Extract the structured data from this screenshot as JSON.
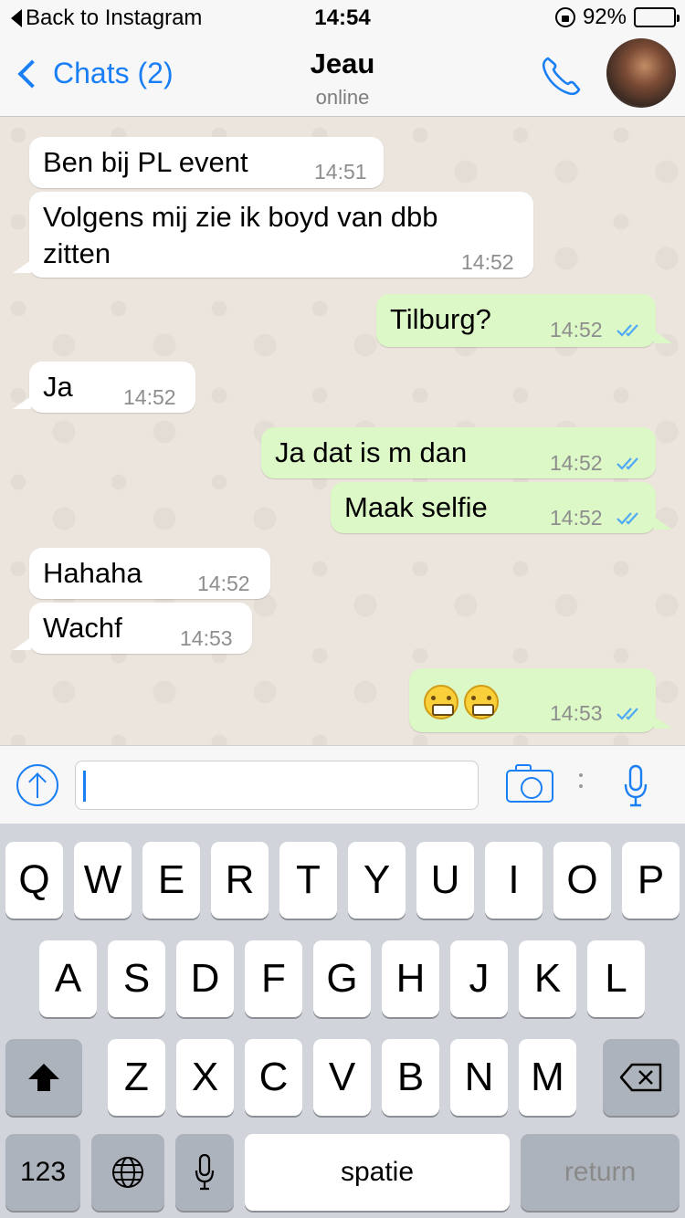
{
  "status_bar": {
    "back_label": "Back to Instagram",
    "time": "14:54",
    "battery": "92%",
    "battery_level": 0.92
  },
  "nav": {
    "back_label": "Chats (2)",
    "contact_name": "Jeau",
    "contact_status": "online",
    "accent_color": "#1a7ff5"
  },
  "messages": [
    {
      "direction": "in",
      "text": "Ben bij PL event",
      "time": "14:51"
    },
    {
      "direction": "in",
      "text": "Volgens mij zie ik boyd van dbb zitten",
      "time": "14:52"
    },
    {
      "direction": "out",
      "text": "Tilburg?",
      "time": "14:52",
      "read": true
    },
    {
      "direction": "in",
      "text": "Ja",
      "time": "14:52"
    },
    {
      "direction": "out",
      "text": "Ja dat is m dan",
      "time": "14:52",
      "read": true
    },
    {
      "direction": "out",
      "text": "Maak selfie",
      "time": "14:52",
      "read": true
    },
    {
      "direction": "in",
      "text": "Hahaha",
      "time": "14:52"
    },
    {
      "direction": "in",
      "text": "Wachf",
      "time": "14:53"
    },
    {
      "direction": "out",
      "text": "",
      "emoji": [
        "grimacing-face",
        "grimacing-face"
      ],
      "time": "14:53",
      "read": true
    }
  ],
  "input": {
    "value": "",
    "icons": [
      "upload-icon",
      "camera-icon",
      "microphone-icon"
    ]
  },
  "keyboard": {
    "row1": [
      "Q",
      "W",
      "E",
      "R",
      "T",
      "Y",
      "U",
      "I",
      "O",
      "P"
    ],
    "row2": [
      "A",
      "S",
      "D",
      "F",
      "G",
      "H",
      "J",
      "K",
      "L"
    ],
    "row3": [
      "Z",
      "X",
      "C",
      "V",
      "B",
      "N",
      "M"
    ],
    "numbers_label": "123",
    "space_label": "spatie",
    "return_label": "return"
  }
}
